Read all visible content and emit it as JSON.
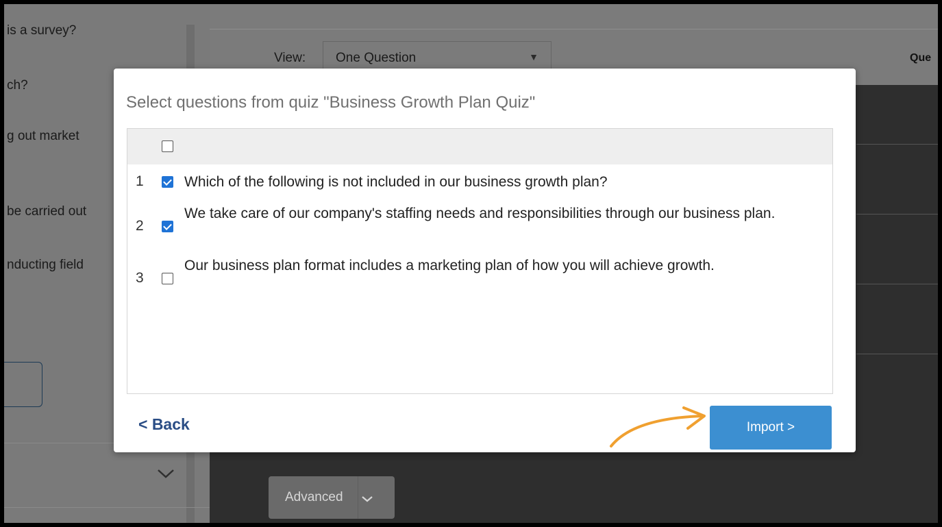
{
  "background": {
    "left_items": [
      "is a survey?",
      "ch?",
      "g out market",
      "be carried out",
      "nducting field"
    ],
    "view_label": "View:",
    "view_value": "One Question",
    "right_header": "Que",
    "advanced_label": "Advanced"
  },
  "modal": {
    "title": "Select questions from quiz \"Business Growth Plan Quiz\"",
    "questions": [
      {
        "num": "1",
        "checked": true,
        "text": "Which of the following is not included in our business growth plan?"
      },
      {
        "num": "2",
        "checked": true,
        "text": "We take care of our company's staffing needs and responsibilities through our business plan."
      },
      {
        "num": "3",
        "checked": false,
        "text": "Our business plan format includes a marketing plan of how you will achieve growth."
      }
    ],
    "back_label": "< Back",
    "import_label": "Import >"
  },
  "colors": {
    "accent": "#3c8fd1",
    "checkbox_checked": "#1f73d6",
    "back_link": "#2a4d85",
    "annotation_arrow": "#f0a030"
  },
  "icons": {
    "select_caret": "caret-down-icon",
    "advanced_chevron": "chevron-down-icon",
    "sidebar_chevron": "chevron-down-icon",
    "annotation": "arrow-icon"
  }
}
